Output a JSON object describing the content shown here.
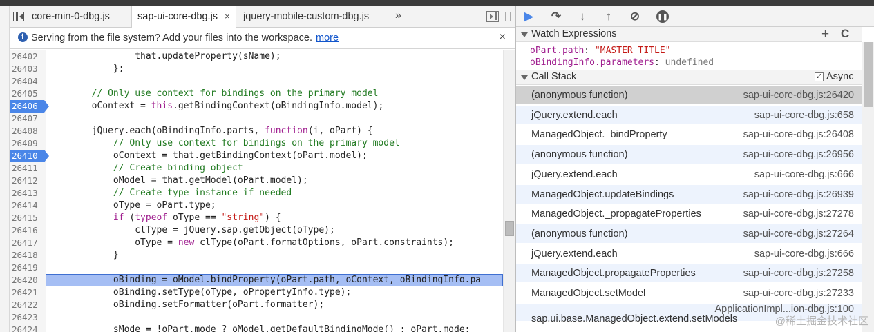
{
  "tabs": [
    {
      "label": "core-min-0-dbg.js",
      "active": false
    },
    {
      "label": "sap-ui-core-dbg.js",
      "active": true,
      "close_label": "×"
    },
    {
      "label": "jquery-mobile-custom-dbg.js",
      "active": false
    }
  ],
  "tab_overflow": "»",
  "infobar": {
    "icon": "i",
    "text": "Serving from the file system? Add your files into the workspace.",
    "link": "more",
    "close": "×"
  },
  "code": {
    "breakpoints": [
      "26406",
      "26410"
    ],
    "execution_line": "26420",
    "lines": [
      {
        "n": "26402",
        "html": "                that.updateProperty(sName);"
      },
      {
        "n": "26403",
        "html": "            };"
      },
      {
        "n": "26404",
        "html": ""
      },
      {
        "n": "26405",
        "html": "        <span class=\"cm\">// Only use context for bindings on the primary model</span>"
      },
      {
        "n": "26406",
        "html": "        oContext = <span class=\"kw\">this</span>.getBindingContext(oBindingInfo.model);"
      },
      {
        "n": "26407",
        "html": ""
      },
      {
        "n": "26408",
        "html": "        jQuery.each(oBindingInfo.parts, <span class=\"kw\">function</span>(i, oPart) {"
      },
      {
        "n": "26409",
        "html": "            <span class=\"cm\">// Only use context for bindings on the primary model</span>"
      },
      {
        "n": "26410",
        "html": "            oContext = that.getBindingContext(oPart.model);"
      },
      {
        "n": "26411",
        "html": "            <span class=\"cm\">// Create binding object</span>"
      },
      {
        "n": "26412",
        "html": "            oModel = that.getModel(oPart.model);"
      },
      {
        "n": "26413",
        "html": "            <span class=\"cm\">// Create type instance if needed</span>"
      },
      {
        "n": "26414",
        "html": "            oType = oPart.type;"
      },
      {
        "n": "26415",
        "html": "            <span class=\"kw\">if</span> (<span class=\"kw\">typeof</span> oType == <span class=\"st\">\"string\"</span>) {"
      },
      {
        "n": "26416",
        "html": "                clType = jQuery.sap.getObject(oType);"
      },
      {
        "n": "26417",
        "html": "                oType = <span class=\"kw\">new</span> clType(oPart.formatOptions, oPart.constraints);"
      },
      {
        "n": "26418",
        "html": "            }"
      },
      {
        "n": "26419",
        "html": ""
      },
      {
        "n": "26420",
        "html": "            oBinding = oModel.bindProperty(oPart.path, oContext, oBindingInfo.pa"
      },
      {
        "n": "26421",
        "html": "            oBinding.setType(oType, oPropertyInfo.type);"
      },
      {
        "n": "26422",
        "html": "            oBinding.setFormatter(oPart.formatter);"
      },
      {
        "n": "26423",
        "html": ""
      },
      {
        "n": "26424",
        "html": "            sMode = !oPart.mode ? oModel.getDefaultBindingMode() : oPart.mode;"
      }
    ]
  },
  "watch": {
    "title": "Watch Expressions",
    "add": "+",
    "refresh": "C",
    "items": [
      {
        "name": "oPart.path",
        "sep": ": ",
        "value": "\"MASTER TITLE\"",
        "kind": "string"
      },
      {
        "name": "oBindingInfo.parameters",
        "sep": ": ",
        "value": "undefined",
        "kind": "undefined"
      }
    ]
  },
  "call_stack": {
    "title": "Call Stack",
    "async_label": "Async",
    "async_checked": "✓",
    "frames": [
      {
        "name": "(anonymous function)",
        "location": "sap-ui-core-dbg.js:26420"
      },
      {
        "name": "jQuery.extend.each",
        "location": "sap-ui-core-dbg.js:658"
      },
      {
        "name": "ManagedObject._bindProperty",
        "location": "sap-ui-core-dbg.js:26408"
      },
      {
        "name": "(anonymous function)",
        "location": "sap-ui-core-dbg.js:26956"
      },
      {
        "name": "jQuery.extend.each",
        "location": "sap-ui-core-dbg.js:666"
      },
      {
        "name": "ManagedObject.updateBindings",
        "location": "sap-ui-core-dbg.js:26939"
      },
      {
        "name": "ManagedObject._propagateProperties",
        "location": "sap-ui-core-dbg.js:27278"
      },
      {
        "name": "(anonymous function)",
        "location": "sap-ui-core-dbg.js:27264"
      },
      {
        "name": "jQuery.extend.each",
        "location": "sap-ui-core-dbg.js:666"
      },
      {
        "name": "ManagedObject.propagateProperties",
        "location": "sap-ui-core-dbg.js:27258"
      },
      {
        "name": "ManagedObject.setModel",
        "location": "sap-ui-core-dbg.js:27233"
      },
      {
        "name": "sap.ui.base.ManagedObject.extend.setModels",
        "location": "ApplicationImpl...ion-dbg.js:100"
      }
    ]
  },
  "watermark": "@稀土掘金技术社区"
}
